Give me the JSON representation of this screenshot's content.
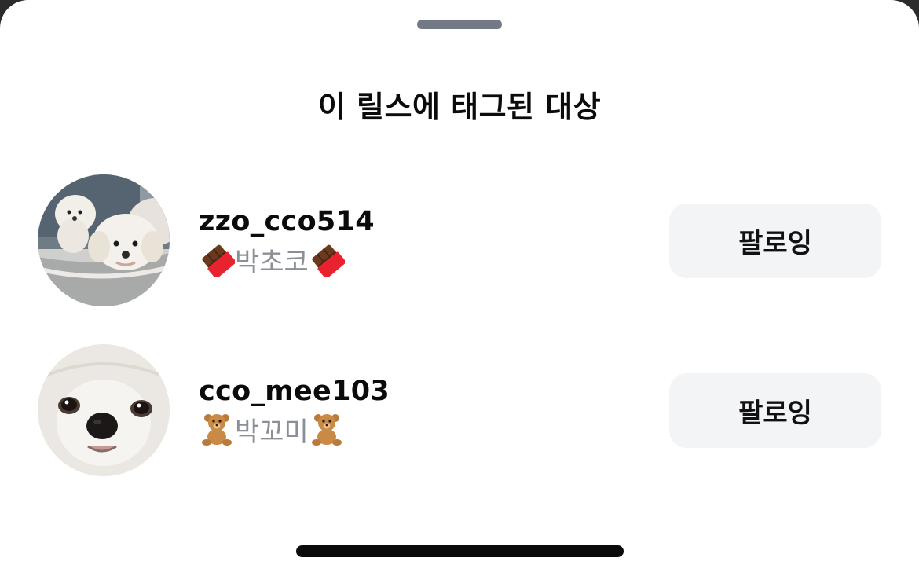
{
  "sheet": {
    "title": "이 릴스에 태그된 대상"
  },
  "tagged_users": [
    {
      "username": "zzo_cco514",
      "display_name": "박초코",
      "emoji_icon": "chocolate-bar-icon",
      "avatar": "white-poodle-puppies-photo",
      "button_label": "팔로잉"
    },
    {
      "username": "cco_mee103",
      "display_name": "박꼬미",
      "emoji_icon": "teddy-bear-icon",
      "avatar": "white-maltese-face-photo",
      "button_label": "팔로잉"
    }
  ],
  "colors": {
    "button_bg": "#f3f4f6",
    "subtitle_text": "#8b8f96",
    "grabber": "#737a86"
  }
}
